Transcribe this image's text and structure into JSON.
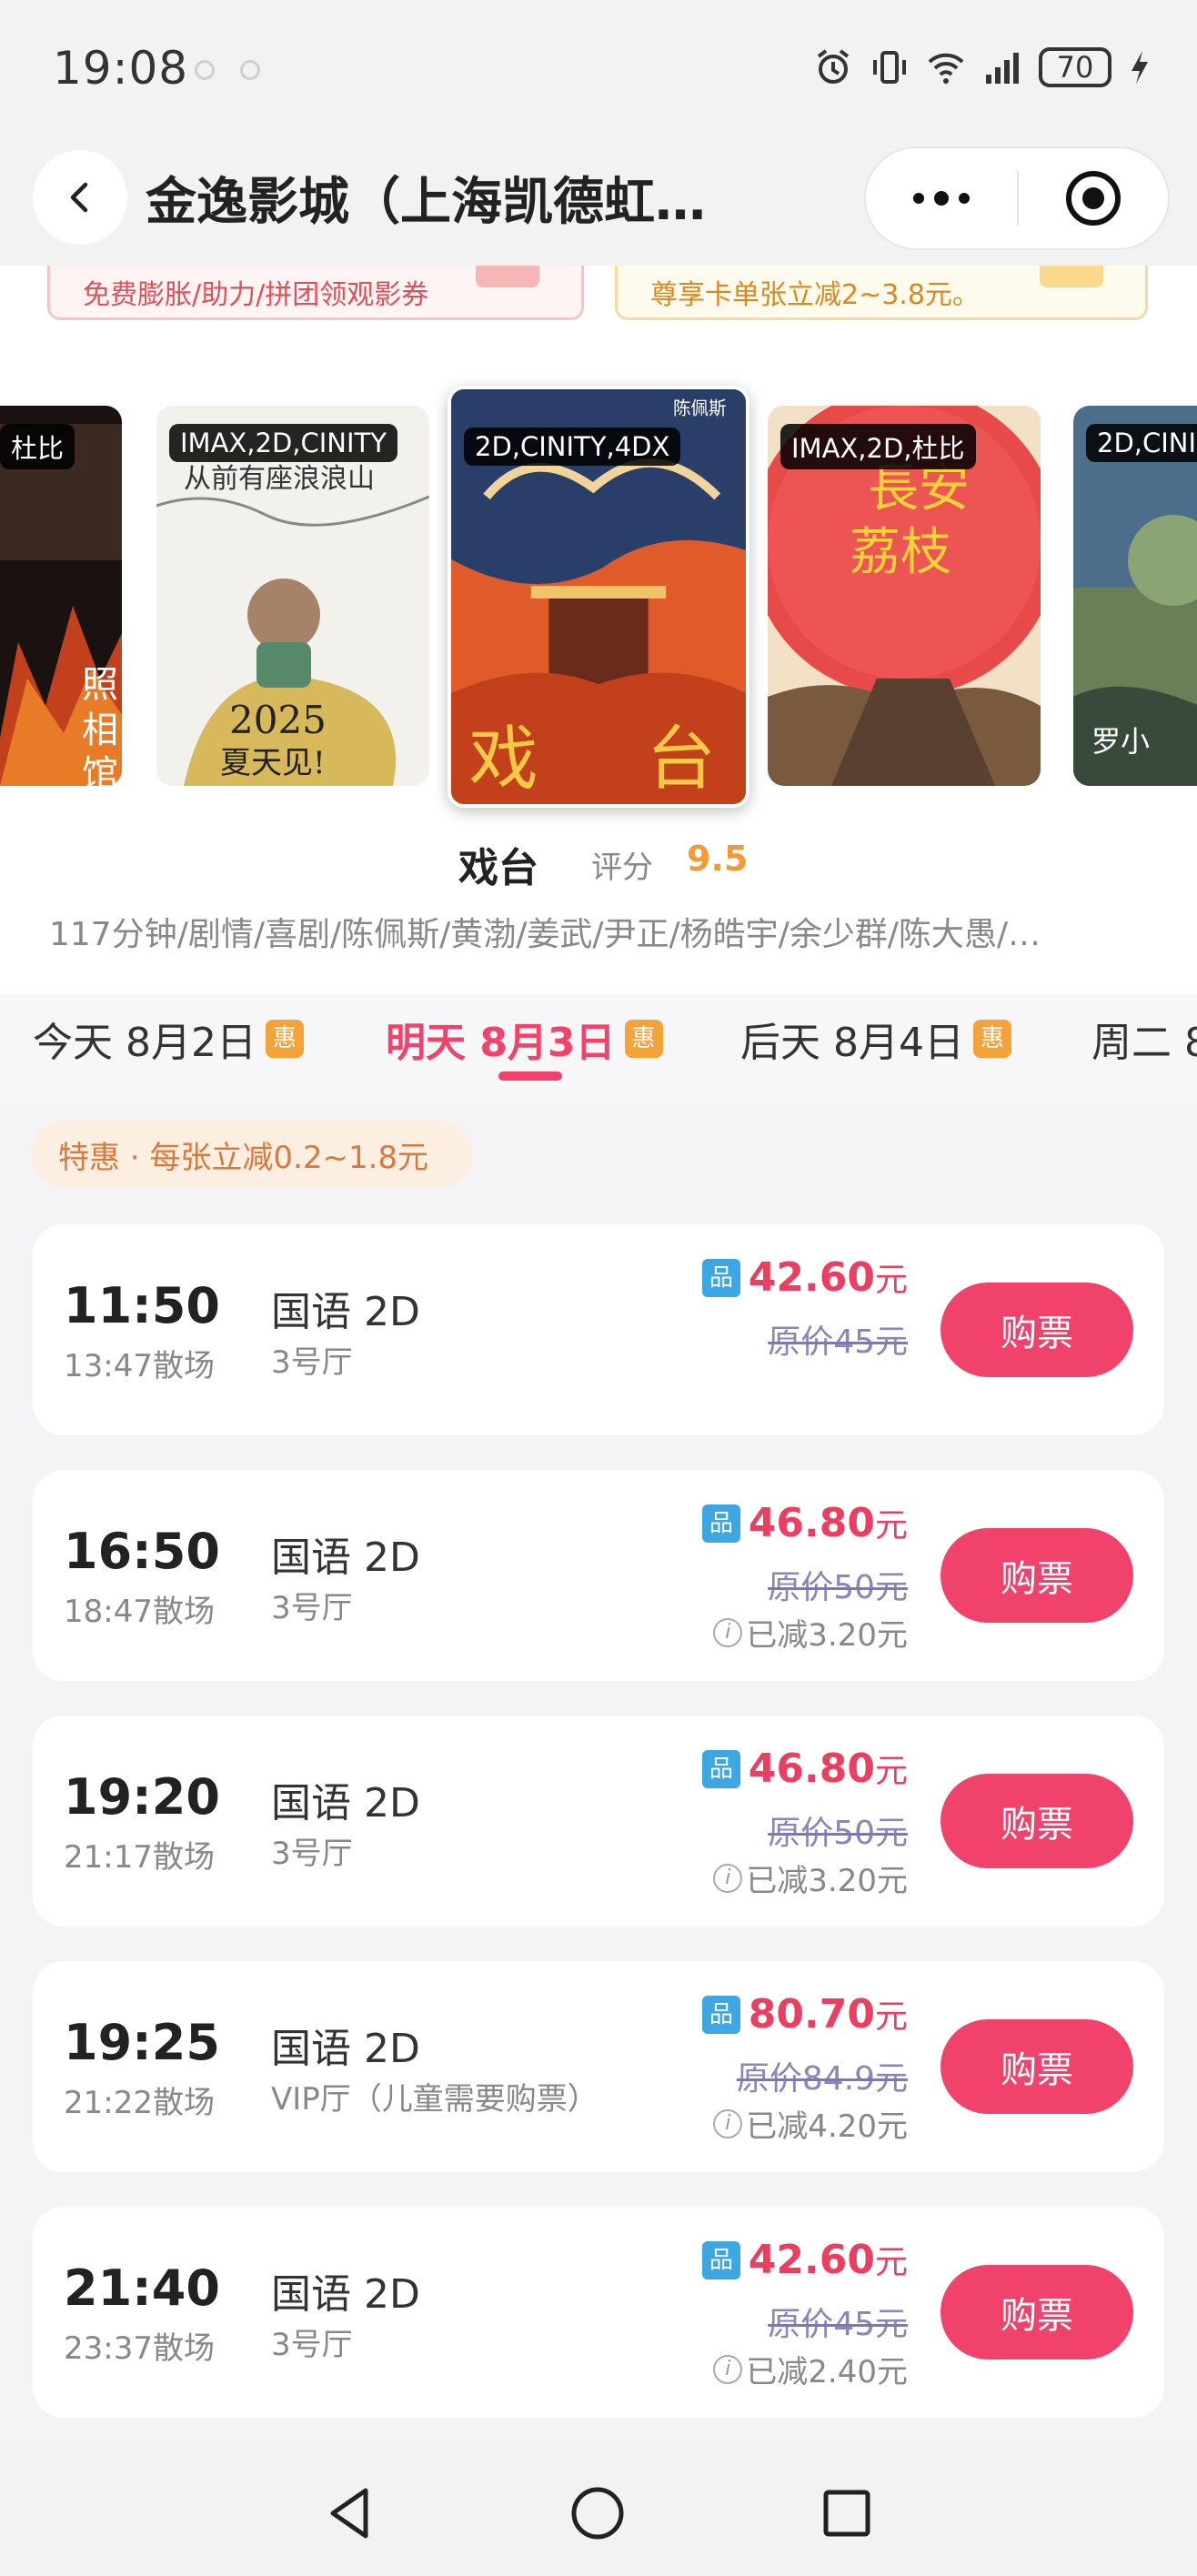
{
  "status_bar": {
    "time": "19:08",
    "battery": "70"
  },
  "header": {
    "title": "金逸影城（上海凯德虹…"
  },
  "promos": [
    {
      "text": "免费膨胀/助力/拼团领观影券"
    },
    {
      "text": "尊享卡单张立减2~3.8元。"
    }
  ],
  "posters": [
    {
      "tag": "杜比",
      "title": "照相馆"
    },
    {
      "tag": "IMAX,2D,CINITY",
      "title": "从前有座浪浪山",
      "subtitle": "2025 夏天见!"
    },
    {
      "tag": "2D,CINITY,4DX",
      "title": "戏台",
      "director": "陈佩斯"
    },
    {
      "tag": "IMAX,2D,杜比",
      "title": "长安的荔枝"
    },
    {
      "tag": "2D,CINI",
      "title": "罗小黑"
    }
  ],
  "movie": {
    "name": "戏台",
    "rating_label": "评分",
    "rating": "9.5",
    "meta": "117分钟/剧情/喜剧/陈佩斯/黄渤/姜武/尹正/杨皓宇/余少群/陈大愚/…"
  },
  "date_tabs": [
    {
      "label": "今天 8月2日",
      "badge": "惠"
    },
    {
      "label": "明天 8月3日",
      "badge": "惠",
      "active": true
    },
    {
      "label": "后天 8月4日",
      "badge": "惠"
    },
    {
      "label": "周二 8"
    }
  ],
  "discount": "特惠 · 每张立减0.2~1.8元",
  "showtimes": [
    {
      "time": "11:50",
      "end": "13:47散场",
      "lang": "国语 2D",
      "hall": "3号厅",
      "badge": "品",
      "price": "42.60",
      "unit": "元",
      "original": "原价45元",
      "saved": ""
    },
    {
      "time": "16:50",
      "end": "18:47散场",
      "lang": "国语 2D",
      "hall": "3号厅",
      "badge": "品",
      "price": "46.80",
      "unit": "元",
      "original": "原价50元",
      "saved": "已减3.20元"
    },
    {
      "time": "19:20",
      "end": "21:17散场",
      "lang": "国语 2D",
      "hall": "3号厅",
      "badge": "品",
      "price": "46.80",
      "unit": "元",
      "original": "原价50元",
      "saved": "已减3.20元"
    },
    {
      "time": "19:25",
      "end": "21:22散场",
      "lang": "国语 2D",
      "hall": "VIP厅（儿童需要购票）",
      "badge": "品",
      "price": "80.70",
      "unit": "元",
      "original": "原价84.9元",
      "saved": "已减4.20元"
    },
    {
      "time": "21:40",
      "end": "23:37散场",
      "lang": "国语 2D",
      "hall": "3号厅",
      "badge": "品",
      "price": "42.60",
      "unit": "元",
      "original": "原价45元",
      "saved": "已减2.40元"
    }
  ],
  "buy_label": "购票",
  "colors": {
    "accent": "#f0426a",
    "rating": "#f29a38",
    "badge_orange": "#f4a23a",
    "badge_blue": "#3da7e4"
  }
}
